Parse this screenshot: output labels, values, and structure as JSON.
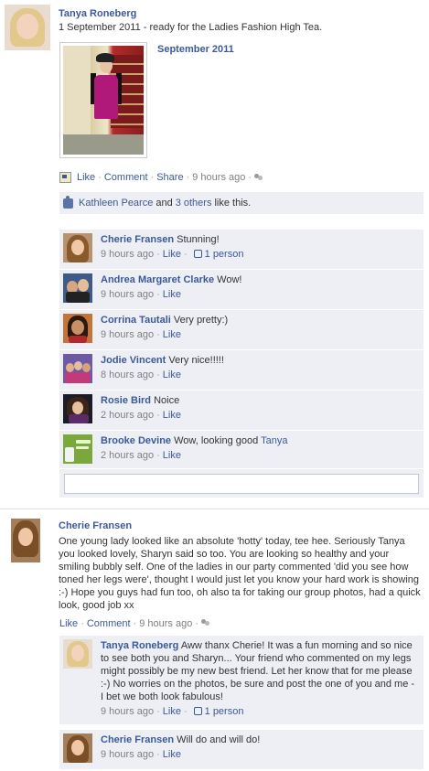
{
  "story1": {
    "author": "Tanya Roneberg",
    "text": "1 September 2011 - ready for the Ladies Fashion High Tea.",
    "album_title": "September 2011",
    "actions": {
      "like": "Like",
      "comment": "Comment",
      "share": "Share",
      "time": "9 hours ago"
    },
    "likes": {
      "liker": "Kathleen Pearce",
      "and_text": "and",
      "others": "3 others",
      "suffix": "like this."
    },
    "comments": [
      {
        "name": "Cherie Fransen",
        "text": "Stunning!",
        "time": "9 hours ago",
        "like": "Like",
        "like_count": "1 person"
      },
      {
        "name": "Andrea Margaret Clarke",
        "text": "Wow!",
        "time": "9 hours ago",
        "like": "Like"
      },
      {
        "name": "Corrina Tautali",
        "text": "Very pretty:)",
        "time": "9 hours ago",
        "like": "Like"
      },
      {
        "name": "Jodie Vincent",
        "text": "Very nice!!!!!",
        "time": "8 hours ago",
        "like": "Like"
      },
      {
        "name": "Rosie Bird",
        "text": "Noice",
        "time": "2 hours ago",
        "like": "Like"
      },
      {
        "name": "Brooke Devine",
        "text": "Wow, looking good",
        "mention": "Tanya",
        "time": "2 hours ago",
        "like": "Like"
      }
    ],
    "comment_input_placeholder": ""
  },
  "story2": {
    "author": "Cherie Fransen",
    "text": "One young lady looked like an absolute 'hotty' today, tee hee. Seriously Tanya you looked lovely, Sharyn said so too. You are looking so healthy and your smiling bubbly self. One of the ladies in our party commented 'did you see how toned her legs were', thought I would just let you know your hard work is showing :-) Hope you guys had fun too, oh also ta for taking our group photos, had a quick look, good job xx",
    "actions": {
      "like": "Like",
      "comment": "Comment",
      "time": "9 hours ago"
    },
    "comments": [
      {
        "name": "Tanya Roneberg",
        "text": "Aww thanx Cherie! It was a fun morning and so nice to see both you and Sharyn... Your friend who commented on my legs might possibly be my new best friend. Let her know that for me please :-) No worries on the photos, be sure and post the one of you and me - I bet we both look fabulous!",
        "time": "9 hours ago",
        "like": "Like",
        "like_count": "1 person"
      },
      {
        "name": "Cherie Fransen",
        "text": "Will do and will do!",
        "time": "9 hours ago",
        "like": "Like"
      }
    ]
  },
  "colors": {
    "link": "#3b5998",
    "comment_bg": "#edeff4",
    "muted": "#808080"
  }
}
